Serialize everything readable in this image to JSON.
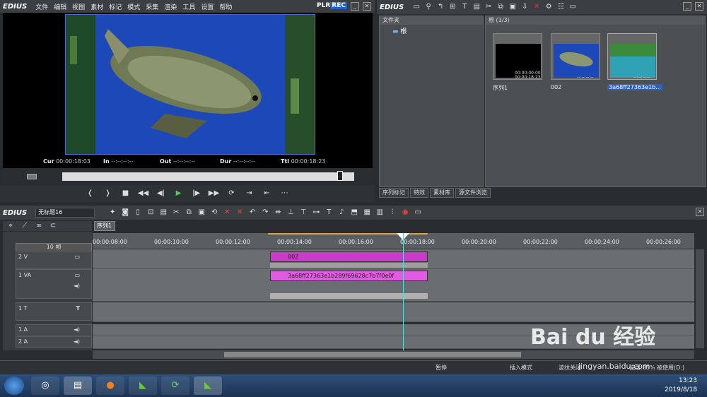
{
  "player": {
    "logo": "EDIUS",
    "menu": [
      "文件",
      "编辑",
      "视图",
      "素材",
      "标记",
      "模式",
      "采集",
      "渲染",
      "工具",
      "设置",
      "帮助"
    ],
    "plr": "PLR",
    "rec": "REC",
    "cur_label": "Cur",
    "cur_value": "00:00:18:03",
    "in_label": "In",
    "in_value": "--:--:--:--",
    "out_label": "Out",
    "out_value": "--:--:--:--",
    "dur_label": "Dur",
    "dur_value": "--:--:--:--",
    "ttl_label": "Ttl",
    "ttl_value": "00:00:18:23",
    "scrub_position": 0.96
  },
  "bin": {
    "logo": "EDIUS",
    "folder_header": "文件夹",
    "root_folder": "根",
    "clip_header": "根 (1/3)",
    "clips": [
      {
        "name": "序列1",
        "timecode": "00:00:00:00",
        "timecode2": "00:00:18:23"
      },
      {
        "name": "002",
        "timecode": "--:--:--:--",
        "timecode2": "--:--:--:--"
      },
      {
        "name": "3a68ff27363e1b...",
        "timecode": "--:--:--:--",
        "timecode2": "--:--:--:--"
      }
    ],
    "tabs": [
      "序列标记",
      "特效",
      "素材库",
      "源文件浏览"
    ]
  },
  "timeline": {
    "logo": "EDIUS",
    "project_name": "无标题16",
    "sequence_tab": "序列1",
    "zoom": "10 帧",
    "ruler": [
      "00:00:08:00",
      "00:00:10:00",
      "00:00:12:00",
      "00:00:14:00",
      "00:00:16:00",
      "00:00:18:00",
      "00:00:20:00",
      "00:00:22:00",
      "00:00:24:00",
      "00:00:26:00"
    ],
    "tracks": [
      {
        "name": "2 V"
      },
      {
        "name": "1 VA"
      },
      {
        "name": "1 T"
      },
      {
        "name": "1 A"
      },
      {
        "name": "2 A"
      }
    ],
    "clip_v2": "002",
    "clip_va": "3a68ff27363e1b289f69628c7b7f0e0f"
  },
  "status": {
    "pause": "暂停",
    "insert_mode": "插入模式",
    "ripple": "波纹关闭",
    "disk": "磁盘:85% 被使用(D:)"
  },
  "taskbar": {
    "time": "13:23",
    "date": "2019/8/18"
  },
  "watermark": {
    "brand": "Bai du 经验",
    "url": "jingyan.baidu.com"
  }
}
